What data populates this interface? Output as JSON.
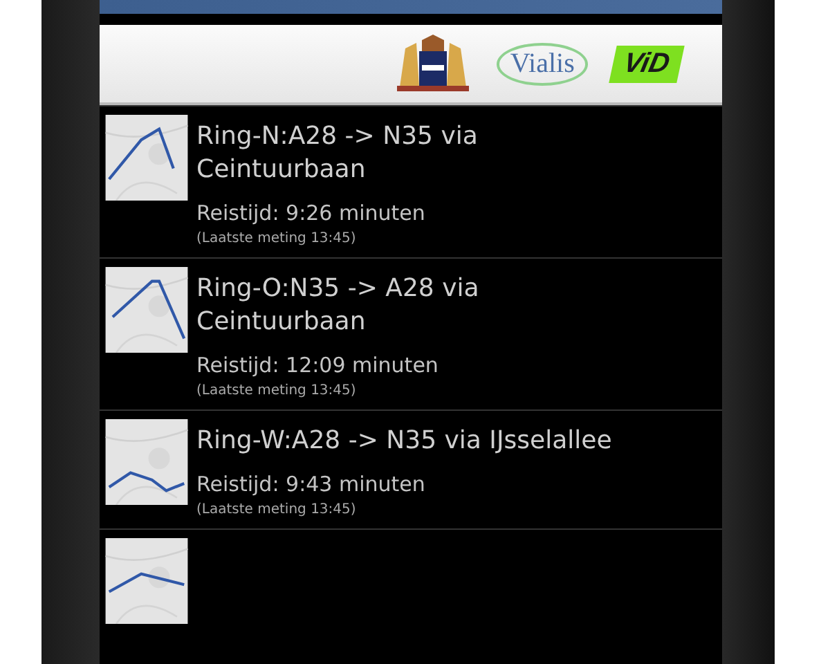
{
  "header": {
    "logos": [
      {
        "kind": "crest"
      },
      {
        "kind": "wordmark",
        "text": "Vialis"
      },
      {
        "kind": "badge",
        "text": "ViD"
      }
    ]
  },
  "routes": [
    {
      "title_lines": [
        "Ring-N:A28 -> N35 via",
        "Ceintuurbaan"
      ],
      "travel_time": "Reistijd: 9:26 minuten",
      "last_measured": "(Laatste meting 13:45)"
    },
    {
      "title_lines": [
        "Ring-O:N35 -> A28 via",
        "Ceintuurbaan"
      ],
      "travel_time": "Reistijd: 12:09 minuten",
      "last_measured": "(Laatste meting 13:45)"
    },
    {
      "title_lines": [
        "Ring-W:A28 -> N35 via IJsselallee"
      ],
      "travel_time": "Reistijd: 9:43 minuten",
      "last_measured": "(Laatste meting 13:45)"
    },
    {
      "kind": "partial"
    }
  ]
}
